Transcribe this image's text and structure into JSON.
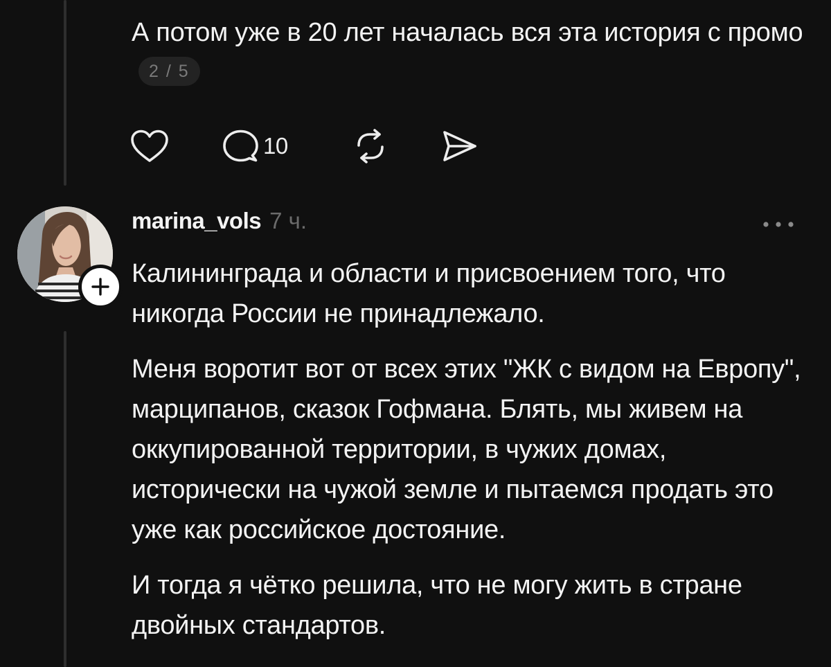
{
  "post": {
    "text": "А потом уже в 20 лет началась вся эта история с промо",
    "counter": "2 / 5"
  },
  "actions": {
    "comment_count": "10"
  },
  "reply": {
    "username": "marina_vols",
    "time": "7 ч.",
    "paragraphs": [
      "Калининграда и области и присвоением того, что никогда России не принадлежало.",
      "Меня воротит вот от всех этих \"ЖК с видом на Европу\", марципанов, сказок Гофмана. Блять, мы живем на оккупированной территории, в чужих домах, исторически на чужой земле и пытаемся продать это уже как российское достояние.",
      "И тогда я чётко решила, что не могу жить в стране двойных стандартов."
    ]
  },
  "icons": {
    "like": "heart-icon",
    "comment": "comment-bubble-icon",
    "repost": "repost-icon",
    "share": "send-icon",
    "more": "more-dots-icon",
    "follow": "plus-icon"
  },
  "colors": {
    "background": "#101010",
    "text": "#f3f3f3",
    "muted": "#6b6b6b",
    "thread_line": "#2e2e2e"
  }
}
